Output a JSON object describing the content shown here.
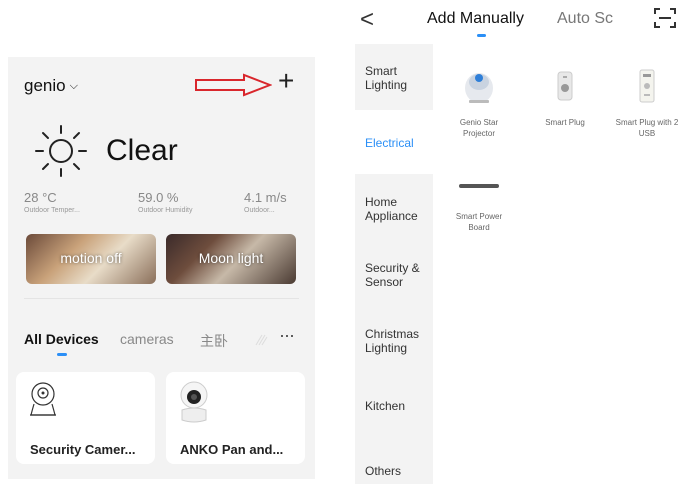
{
  "left": {
    "home_name": "genio",
    "weather": {
      "condition": "Clear",
      "stats": [
        {
          "value": "28 °C",
          "label": "Outdoor Temper..."
        },
        {
          "value": "59.0 %",
          "label": "Outdoor Humidity"
        },
        {
          "value": "4.1 m/s",
          "label": "Outdoor..."
        }
      ]
    },
    "scenes": [
      {
        "label": "motion off"
      },
      {
        "label": "Moon light"
      }
    ],
    "tabs": [
      {
        "label": "All Devices"
      },
      {
        "label": "cameras"
      },
      {
        "label": "主卧"
      }
    ],
    "more": "···",
    "devices": [
      {
        "name": "Security Camer..."
      },
      {
        "name": "ANKO Pan and..."
      }
    ],
    "colors": {
      "accent": "#2b8ff6",
      "annotation_arrow": "#d9262c"
    }
  },
  "right": {
    "back": "<",
    "tabs": [
      {
        "label": "Add Manually"
      },
      {
        "label": "Auto Sc"
      }
    ],
    "categories": [
      {
        "label": "Smart Lighting"
      },
      {
        "label": "Electrical"
      },
      {
        "label": "Home Appliance"
      },
      {
        "label": "Security & Sensor"
      },
      {
        "label": "Christmas Lighting"
      },
      {
        "label": "Kitchen"
      },
      {
        "label": "Others"
      }
    ],
    "products": [
      {
        "name": "Genio Star Projector"
      },
      {
        "name": "Smart Plug"
      },
      {
        "name": "Smart Plug with 2 USB"
      },
      {
        "name": "Smart Power Board"
      }
    ]
  }
}
